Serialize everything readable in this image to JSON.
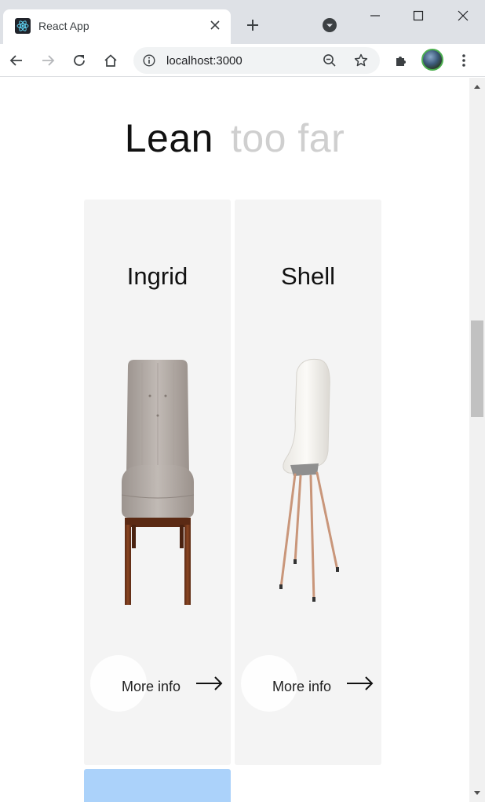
{
  "browser": {
    "tab_title": "React App",
    "url": "localhost:3000",
    "icons": {
      "favicon": "react-logo-icon",
      "tab_close": "close-icon",
      "new_tab": "plus-icon",
      "tab_search": "tab-search-icon",
      "minimize": "minimize-icon",
      "maximize": "maximize-icon",
      "close": "close-icon",
      "back": "back-arrow-icon",
      "forward": "forward-arrow-icon",
      "reload": "reload-icon",
      "home": "home-icon",
      "site_info": "info-icon",
      "zoom": "zoom-out-icon",
      "bookmark": "star-icon",
      "extensions": "puzzle-icon",
      "menu": "kebab-menu-icon"
    }
  },
  "page": {
    "heading_word_1": "Lean",
    "heading_word_2": "too far",
    "colors": {
      "card_background": "#f4f4f4",
      "heading_muted": "#cfcfcf",
      "partial_card": "#abd2fa"
    },
    "products": [
      {
        "name": "Ingrid",
        "more_label": "More info",
        "image": "upholstered-chair-photo"
      },
      {
        "name": "Shell",
        "more_label": "More info",
        "image": "shell-chair-photo"
      }
    ]
  },
  "scrollbar": {
    "scroll_position": 0.38,
    "visible_fraction": 0.14
  }
}
